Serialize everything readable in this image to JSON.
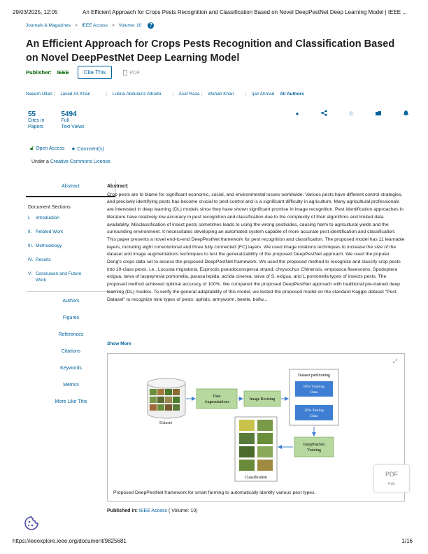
{
  "print_header": {
    "date": "29/03/2025, 12:05",
    "page_title": "An Efficient Approach for Crops Pests Recognition and Classification Based on Novel DeepPestNet Deep Learning Model | IEEE ..."
  },
  "breadcrumb": [
    "Journals & Magazines",
    "IEEE Access",
    "Volume: 10"
  ],
  "breadcrumb_sep": ">",
  "help_icon_glyph": "?",
  "title": "An Efficient Approach for Crops Pests Recognition and Classification Based on Novel DeepPestNet Deep Learning Model",
  "publisher": {
    "label": "Publisher:",
    "name": "IEEE"
  },
  "cite_label": "Cite This",
  "pdf_label": "PDF",
  "authors": [
    "Naeem Ullah",
    "Javed Ali Khan",
    "Lubna Abdulaziz Alharbi",
    "Asaf Raza",
    "Wahab Khan",
    "Ijaz Ahmad"
  ],
  "all_authors_label": "All Authors",
  "metrics": [
    {
      "num": "55",
      "l1": "Cites in",
      "l2": "Papers"
    },
    {
      "num": "5494",
      "l1": "Full",
      "l2": "Text Views"
    }
  ],
  "action_icons": [
    "info-icon",
    "share-icon",
    "copyright-icon",
    "folder-icon",
    "bell-icon"
  ],
  "open_access_label": "Open Access",
  "comments_label": "Comment(s)",
  "license": {
    "prefix": "Under a",
    "link": "Creative Commons License"
  },
  "nav": {
    "abstract_tab": "Abstract",
    "sections_title": "Document Sections",
    "sections": [
      {
        "num": "I.",
        "label": "Introduction"
      },
      {
        "num": "II.",
        "label": "Related Work"
      },
      {
        "num": "III.",
        "label": "Methodology"
      },
      {
        "num": "IV.",
        "label": "Results"
      },
      {
        "num": "V.",
        "label": "Conclusion and Future Work"
      }
    ],
    "links": [
      "Authors",
      "Figures",
      "References",
      "Citations",
      "Keywords",
      "Metrics",
      "More Like This"
    ]
  },
  "abstract": {
    "heading": "Abstract:",
    "text": "Crop pests are to blame for significant economic, social, and environmental losses worldwide. Various pests have different control strategies, and precisely identifying pests has become crucial to pest control and is a significant difficulty in agriculture. Many agricultural professionals are interested in deep learning (DL) models since they have shown significant promise in image recognition. Pest identification approaches in literature have relatively low accuracy in pest recognition and classification due to the complexity of their algorithms and limited data availability. Misclassification of insect pests sometimes leads to using the wrong pesticides, causing harm to agricultural yields and the surrounding environment. It necessitates developing an automated system capable of more accurate pest identification and classification. This paper presents a novel end-to-end DeepPestNet framework for pest recognition and classification. The proposed model has 11 learnable layers, including eight convolutional and three fully connected (FC) layers. We used image rotations techniques to increase the size of the dataset and image augmentations techniques to test the generalizability of the proposed DeepPestNet approach. We used the popular Deng's crops data set to assess the proposed DeepPestNet framework. We used the proposed method to recognize and classify crop pests into 10-class pests, i.e., Locusta migratoria, Euproctis pseudoconspersa strand, chrysochus Chinensis, empoasca flavescens, Spodoptera exigua, larva of laspeyresia pomonella, parasa lepida, acrida cinerea, larva of S. exigua, and L.pomonella types of insects pests. The proposed method achieved optimal accuracy of 100%. We compared the proposed DeepPestNet approach with traditional pre-trained deep learning (DL) models. To verify the general adaptability of this model, we tested the proposed model on the standard Kaggle dataset “Pest Dataset” to recognize nine types of pests: aphids, armyworm, beetle, bollw..."
  },
  "show_more_label": "Show More",
  "figure": {
    "dataset_label": "Dataset",
    "data_aug": [
      "Data",
      "Augmentations"
    ],
    "image_resizing": "Image Resizing",
    "partition_title": "Dataset partitioning",
    "training": [
      "80% Training",
      "Data"
    ],
    "testing": [
      "20% Testing",
      "Data"
    ],
    "deeppestnet": [
      "DeepPestNet",
      "Training"
    ],
    "classification": "Classification",
    "caption": "Proposed DeepPestNet framework for smart farming to automatically identify various pest types.",
    "colors": {
      "green": "#b7d9a0",
      "green_border": "#7fae63",
      "blue": "#3f7fd3"
    }
  },
  "published_in": {
    "label": "Published in:",
    "journal": "IEEE Access",
    "volume": "( Volume: 10)"
  },
  "pdf_float": {
    "label": "PDF",
    "help": "Help"
  },
  "footer": {
    "url": "https://ieeexplore.ieee.org/document/9825681",
    "page": "1/16"
  }
}
